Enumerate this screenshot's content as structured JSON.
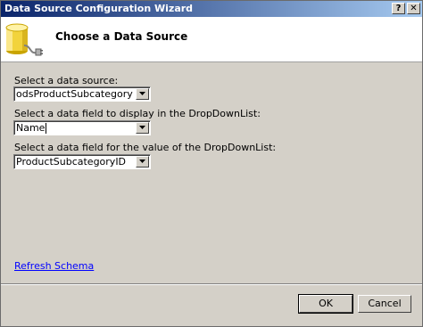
{
  "window": {
    "title": "Data Source Configuration Wizard",
    "help_label": "?",
    "close_label": "✕"
  },
  "header": {
    "title": "Choose a Data Source",
    "icon": "database-icon"
  },
  "form": {
    "data_source": {
      "label": "Select a data source:",
      "value": "odsProductSubcategory"
    },
    "display_field": {
      "label": "Select a data field to display in the DropDownList:",
      "value": "Name"
    },
    "value_field": {
      "label": "Select a data field for the value of the DropDownList:",
      "value": "ProductSubcategoryID"
    }
  },
  "links": {
    "refresh_schema": "Refresh Schema"
  },
  "buttons": {
    "ok": "OK",
    "cancel": "Cancel"
  },
  "colors": {
    "titlebar_start": "#0a246a",
    "titlebar_end": "#a6caf0",
    "dialog_bg": "#d4d0c8",
    "link": "#0000ff"
  }
}
